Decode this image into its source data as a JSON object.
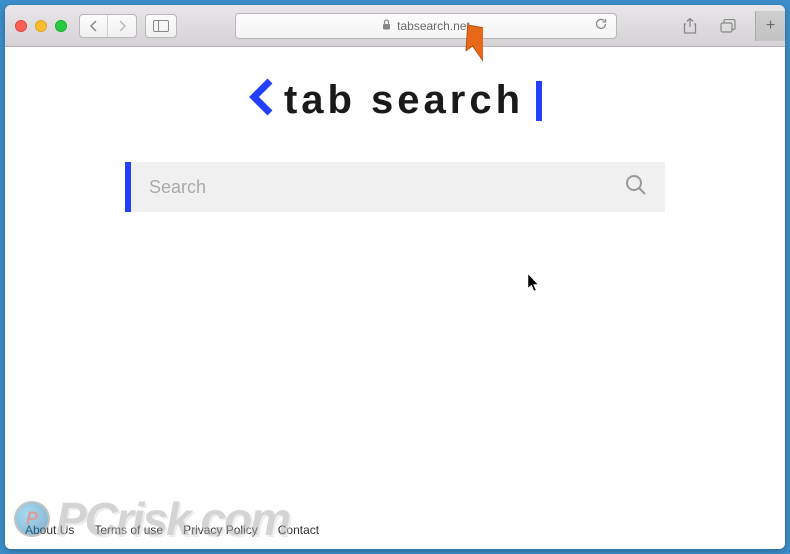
{
  "browser": {
    "url": "tabsearch.net"
  },
  "page": {
    "logo_text": "tab search",
    "search_placeholder": "Search"
  },
  "footer": {
    "links": [
      "About Us",
      "Terms of use",
      "Privacy Policy",
      "Contact"
    ]
  },
  "watermark": {
    "text": "PCrisk.com"
  }
}
